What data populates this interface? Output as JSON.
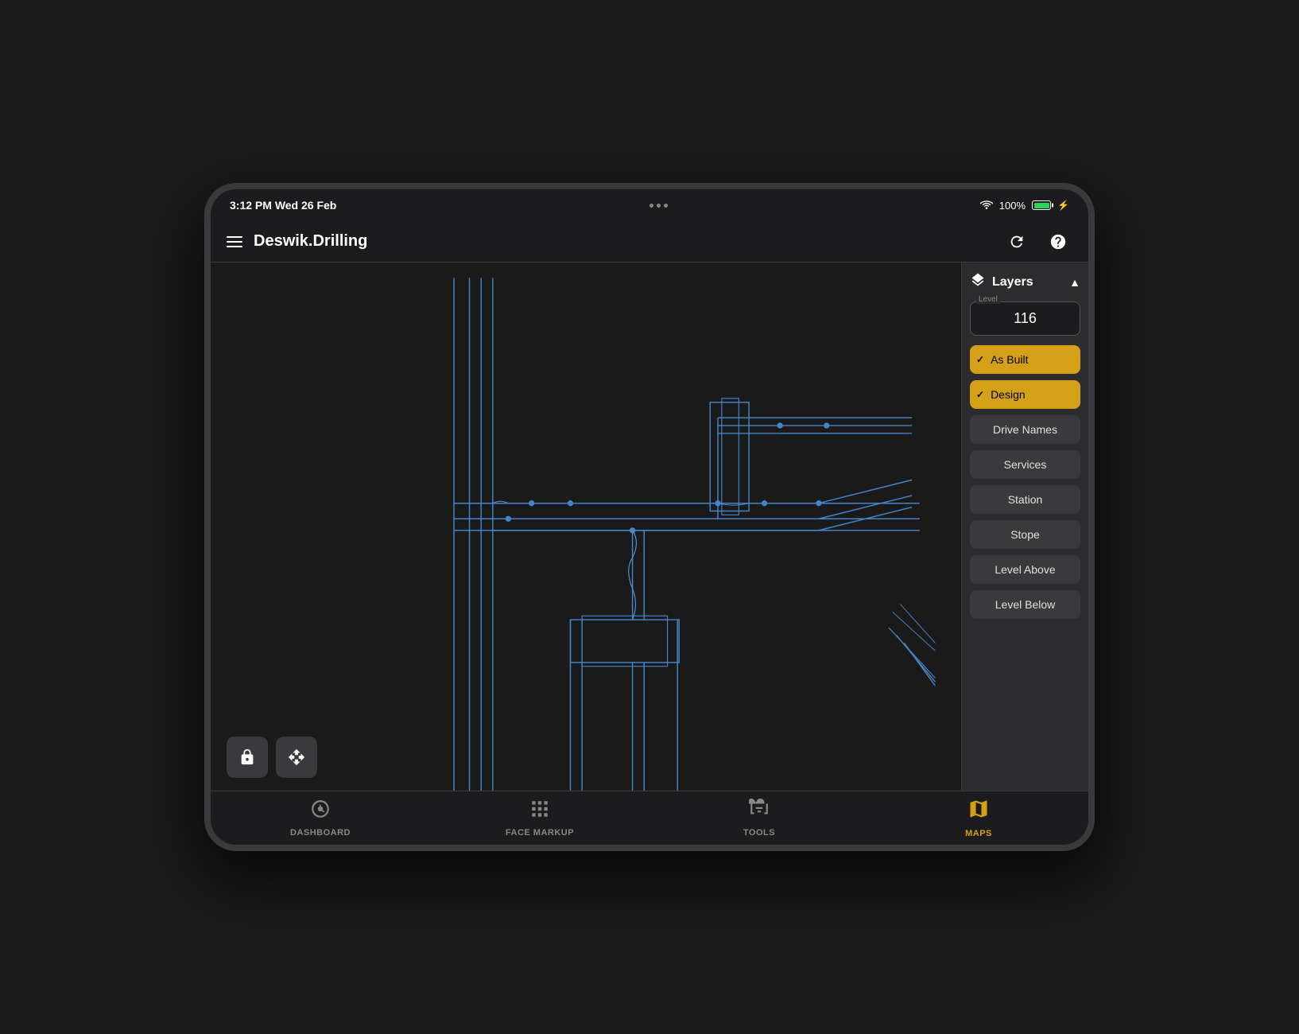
{
  "status_bar": {
    "time": "3:12 PM",
    "date": "Wed 26 Feb",
    "battery_percent": "100%"
  },
  "header": {
    "app_title": "Deswik.Drilling",
    "menu_icon": "≡",
    "refresh_label": "refresh-icon",
    "help_label": "help-icon"
  },
  "layers_panel": {
    "title": "Layers",
    "collapse_icon": "▲",
    "layers_icon": "layers",
    "level_label": "Level",
    "level_value": "116",
    "buttons": [
      {
        "label": "As Built",
        "active": true,
        "id": "as-built"
      },
      {
        "label": "Design",
        "active": true,
        "id": "design"
      },
      {
        "label": "Drive Names",
        "active": false,
        "id": "drive-names"
      },
      {
        "label": "Services",
        "active": false,
        "id": "services"
      },
      {
        "label": "Station",
        "active": false,
        "id": "station"
      },
      {
        "label": "Stope",
        "active": false,
        "id": "stope"
      },
      {
        "label": "Level Above",
        "active": false,
        "id": "level-above"
      },
      {
        "label": "Level Below",
        "active": false,
        "id": "level-below"
      }
    ]
  },
  "bottom_controls": {
    "lock_icon": "🔓",
    "move_icon": "✛"
  },
  "bottom_nav": {
    "items": [
      {
        "label": "DASHBOARD",
        "icon": "dashboard",
        "active": false,
        "id": "dashboard"
      },
      {
        "label": "FACE MARKUP",
        "icon": "face-markup",
        "active": false,
        "id": "face-markup"
      },
      {
        "label": "TOOLS",
        "icon": "tools",
        "active": false,
        "id": "tools"
      },
      {
        "label": "MAPS",
        "icon": "maps",
        "active": true,
        "id": "maps"
      }
    ]
  }
}
